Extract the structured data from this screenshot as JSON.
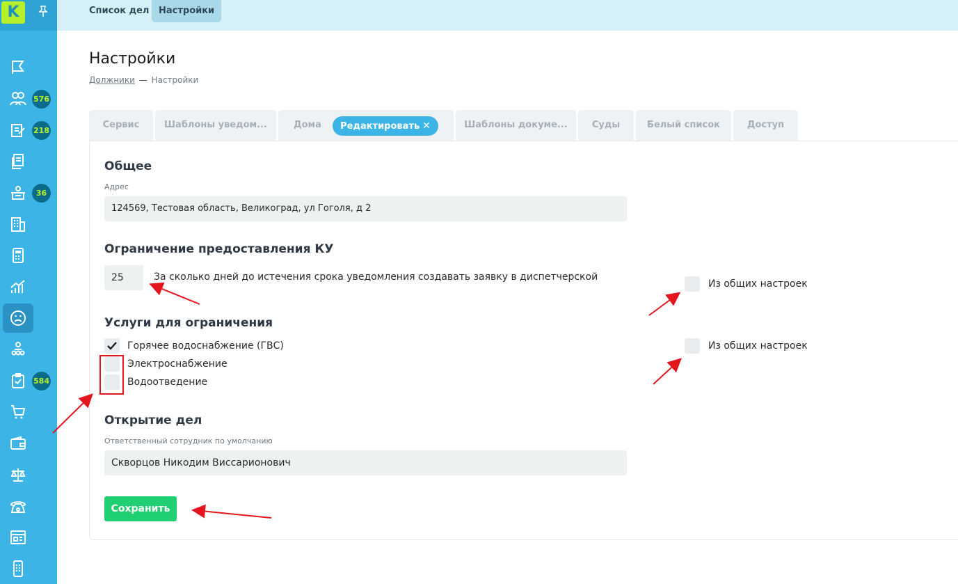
{
  "app": {
    "logo_letter": "K"
  },
  "sidebar": {
    "badges": {
      "users": "576",
      "notes": "218",
      "reception": "36",
      "tasks": "584"
    }
  },
  "topbar": {
    "tabs": [
      {
        "label": "Список дел"
      },
      {
        "label": "Настройки"
      }
    ]
  },
  "page": {
    "title": "Настройки",
    "breadcrumb": {
      "link": "Должники",
      "separator": "—",
      "current": "Настройки"
    }
  },
  "settings_tabs": {
    "items": [
      {
        "label": "Сервис"
      },
      {
        "label": "Шаблоны уведом..."
      },
      {
        "label": "Дома"
      },
      {
        "label": "Редактировать"
      },
      {
        "label": "Шаблоны докуме..."
      },
      {
        "label": "Суды"
      },
      {
        "label": "Белый список"
      },
      {
        "label": "Доступ"
      }
    ],
    "close_glyph": "✕"
  },
  "form": {
    "general": {
      "heading": "Общее",
      "address_label": "Адрес",
      "address_value": "124569, Тестовая область, Великоград, ул Гоголя, д 2"
    },
    "restriction": {
      "heading": "Ограничение предоставления КУ",
      "days_value": "25",
      "days_text": "За сколько дней до истечения срока уведомления создавать заявку в диспетчерской",
      "inherit_label": "Из общих настроек",
      "inherit_checked": false
    },
    "services": {
      "heading": "Услуги для ограничения",
      "items": [
        {
          "label": "Горячее водоснабжение (ГВС)",
          "checked": true
        },
        {
          "label": "Электроснабжение",
          "checked": false
        },
        {
          "label": "Водоотведение",
          "checked": false
        }
      ],
      "inherit_label": "Из общих настроек",
      "inherit_checked": false
    },
    "cases": {
      "heading": "Открытие дел",
      "employee_label": "Ответственный сотрудник по умолчанию",
      "employee_value": "Скворцов Никодим Виссарионович"
    },
    "save_label": "Сохранить"
  },
  "colors": {
    "sidebar": "#3cb5e6",
    "accent": "#3cb5e6",
    "save_button": "#1fcf72",
    "badge_bg": "#0a6b8a",
    "badge_text": "#b6f02a",
    "annotation": "#e3161d"
  }
}
